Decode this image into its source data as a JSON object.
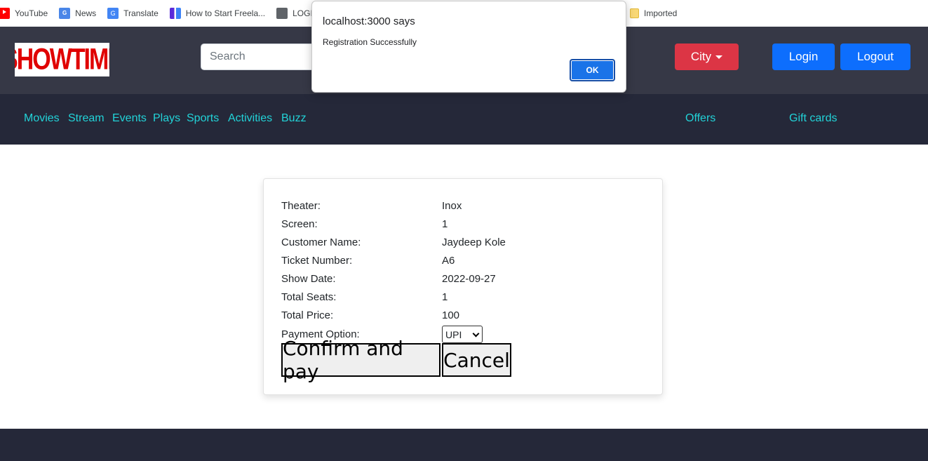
{
  "bookmarks": [
    {
      "label": "YouTube",
      "icon": "youtube-icon"
    },
    {
      "label": "News",
      "icon": "news-icon"
    },
    {
      "label": "Translate",
      "icon": "translate-icon"
    },
    {
      "label": "How to Start Freela...",
      "icon": "bookmark-icon"
    },
    {
      "label": "LOGI",
      "icon": "globe-icon"
    },
    {
      "label": "Imported",
      "icon": "folder-icon"
    }
  ],
  "header": {
    "logo_text": "SHOWTIME",
    "search_placeholder": "Search",
    "city_label": "City",
    "login_label": "Login",
    "logout_label": "Logout"
  },
  "nav": {
    "items": [
      "Movies",
      "Stream",
      "Events",
      "Plays",
      "Sports",
      "Activities",
      "Buzz"
    ],
    "offers": "Offers",
    "gift_cards": "Gift cards"
  },
  "booking": {
    "rows": [
      {
        "label": "Theater:",
        "value": "Inox"
      },
      {
        "label": "Screen:",
        "value": "1"
      },
      {
        "label": "Customer Name:",
        "value": "Jaydeep Kole"
      },
      {
        "label": "Ticket Number:",
        "value": "A6"
      },
      {
        "label": "Show Date:",
        "value": "2022-09-27"
      },
      {
        "label": "Total Seats:",
        "value": "1"
      },
      {
        "label": "Total Price:",
        "value": "100"
      }
    ],
    "payment_label": "Payment Option:",
    "payment_selected": "UPI",
    "confirm_label": "Confirm and pay",
    "cancel_label": "Cancel"
  },
  "dialog": {
    "title": "localhost:3000 says",
    "message": "Registration Successfully",
    "ok_label": "OK"
  },
  "colors": {
    "header_bg": "#363846",
    "nav_bg": "#252839",
    "nav_link": "#22d3d8",
    "city_button": "#dc3545",
    "primary_button": "#0d6efd",
    "logo_red": "#e00000"
  }
}
